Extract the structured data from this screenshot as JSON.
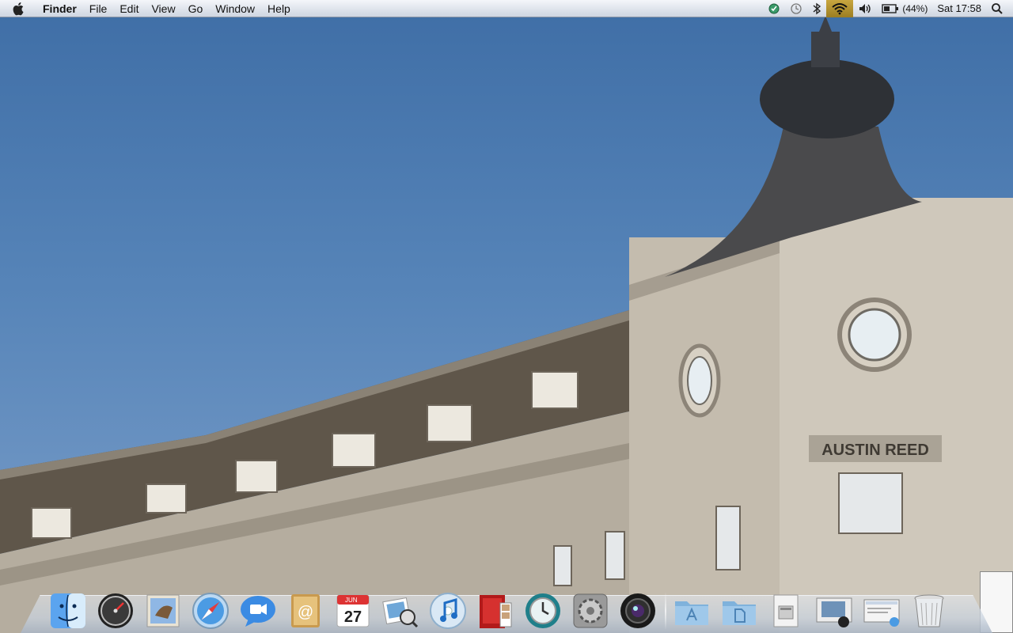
{
  "menubar": {
    "apple_icon": "apple-icon",
    "app_name": "Finder",
    "menus": [
      "File",
      "Edit",
      "View",
      "Go",
      "Window",
      "Help"
    ],
    "status": {
      "sync_icon": "sync-icon",
      "time_machine_icon": "time-machine-icon",
      "bluetooth_icon": "bluetooth-icon",
      "wifi_icon": "wifi-icon",
      "volume_icon": "volume-icon",
      "battery_icon": "battery-icon",
      "battery_percent": "(44%)",
      "clock": "Sat 17:58",
      "spotlight_icon": "spotlight-icon"
    }
  },
  "wallpaper": {
    "sign_text": "AUSTIN REED"
  },
  "dock": {
    "apps": [
      {
        "name": "finder-icon",
        "running": true
      },
      {
        "name": "dashboard-icon",
        "running": false
      },
      {
        "name": "mail-icon",
        "running": false
      },
      {
        "name": "safari-icon",
        "running": true
      },
      {
        "name": "ichat-icon",
        "running": true
      },
      {
        "name": "address-book-icon",
        "running": false
      },
      {
        "name": "ical-icon",
        "running": false
      },
      {
        "name": "preview-icon",
        "running": false
      },
      {
        "name": "itunes-icon",
        "running": false
      },
      {
        "name": "photo-booth-icon",
        "running": false
      },
      {
        "name": "time-machine-icon",
        "running": false
      },
      {
        "name": "system-preferences-icon",
        "running": false
      },
      {
        "name": "iphoto-camera-icon",
        "running": true
      }
    ],
    "stacks": [
      {
        "name": "applications-folder-icon"
      },
      {
        "name": "documents-folder-icon"
      },
      {
        "name": "installer-disk-icon"
      },
      {
        "name": "minimized-window-1-icon"
      },
      {
        "name": "minimized-window-2-icon"
      },
      {
        "name": "trash-icon"
      }
    ],
    "ical_month": "JUN",
    "ical_day": "27"
  },
  "colors": {
    "sky": "#4b7aad",
    "building_stone": "#b9b2a5",
    "roof_slate": "#5a5145",
    "menubar_highlight": "#b8962f"
  }
}
